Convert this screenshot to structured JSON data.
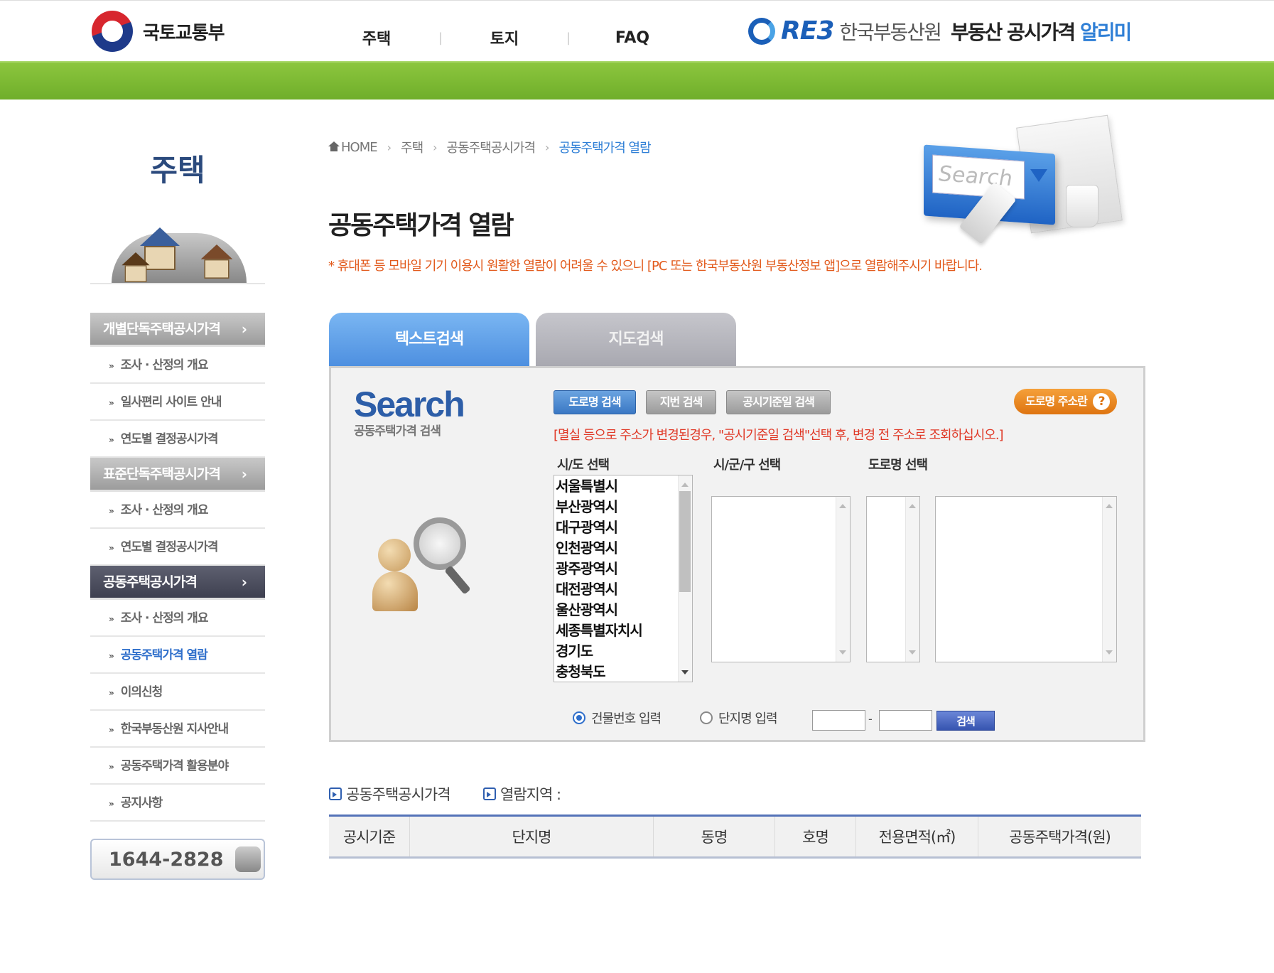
{
  "header": {
    "gov_name": "국토교통부",
    "nav": [
      "주택",
      "토지",
      "FAQ"
    ],
    "nav_sep": "|",
    "reb_mark": "RE3",
    "reb_org": "한국부동산원",
    "reb_service": "부동산 공시가격",
    "reb_alimi": "알리미"
  },
  "sidebar": {
    "title": "주택",
    "categories": [
      {
        "label": "개별단독주택공시가격",
        "chev": "›",
        "items": [
          "조사 · 산정의 개요",
          "일사편리 사이트 안내",
          "연도별 결정공시가격"
        ]
      },
      {
        "label": "표준단독주택공시가격",
        "chev": "›",
        "items": [
          "조사 · 산정의 개요",
          "연도별 결정공시가격"
        ]
      },
      {
        "label": "공동주택공시가격",
        "chev": "›",
        "items": [
          "조사 · 산정의 개요",
          "공동주택가격 열람",
          "이의신청",
          "한국부동산원 지사안내",
          "공동주택가격 활용분야",
          "공지사항"
        ]
      }
    ],
    "arrow": "»",
    "phone": "1644-2828"
  },
  "breadcrumb": {
    "home": "HOME",
    "sep": "›",
    "items": [
      "주택",
      "공동주택공시가격",
      "공동주택가격 열람"
    ]
  },
  "page": {
    "title": "공동주택가격 열람",
    "notice": "* 휴대폰 등 모바일 기기 이용시 원활한 열람이 어려울 수 있으니 [PC 또는 한국부동산원 부동산정보 앱]으로 열람해주시기 바랍니다."
  },
  "illustration": {
    "field_text": "Search"
  },
  "tabs": [
    "텍스트검색",
    "지도검색"
  ],
  "search": {
    "logo_big": "Search",
    "logo_small": "공동주택가격 검색",
    "buttons": [
      "도로명 검색",
      "지번 검색",
      "공시기준일 검색"
    ],
    "help_button": "도로명 주소란",
    "help_q": "?",
    "warning": "[멸실 등으로 주소가 변경된경우, \"공시기준일 검색\"선택 후, 변경 전 주소로 조회하십시오.]",
    "labels": {
      "sido": "시/도 선택",
      "sigungu": "시/군/구 선택",
      "road": "도로명 선택"
    },
    "sido_options": [
      "서울특별시",
      "부산광역시",
      "대구광역시",
      "인천광역시",
      "광주광역시",
      "대전광역시",
      "울산광역시",
      "세종특별자치시",
      "경기도",
      "충청북도"
    ],
    "radio_bldg": "건물번호 입력",
    "radio_complex": "단지명 입력",
    "dash": "-",
    "submit": "검색"
  },
  "results": {
    "title_price": "공동주택공시가격",
    "title_region": "열람지역 :",
    "columns": [
      "공시기준",
      "단지명",
      "동명",
      "호명",
      "전용면적(㎡)",
      "공동주택가격(원)"
    ]
  },
  "colors": {
    "green_bar": "#7bb834",
    "active_tab": "#5d9be6",
    "notice": "#e25a1c",
    "current_link": "#2f6fcb",
    "active_category": "#4a4c5c"
  }
}
